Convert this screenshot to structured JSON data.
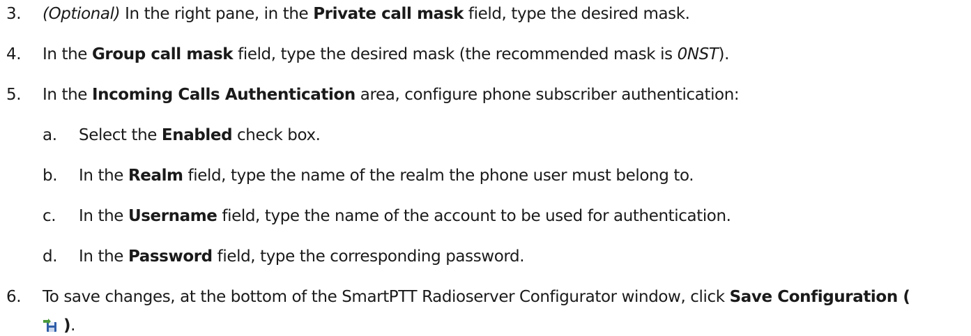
{
  "steps": [
    {
      "number": "3.",
      "optional_label": "(Optional)",
      "text_before": " In the right pane, in the ",
      "bold": "Private call mask",
      "text_after": " field, type the desired mask."
    },
    {
      "number": "4.",
      "text_before": "In the ",
      "bold": "Group call mask",
      "text_middle": " field, type the desired mask (the recommended mask is ",
      "italic": "0NST",
      "text_after": ")."
    },
    {
      "number": "5.",
      "text_before": "In the ",
      "bold": "Incoming Calls Authentication",
      "text_after": " area, configure phone subscriber authentication:",
      "substeps": [
        {
          "letter": "a.",
          "text_before": "Select the ",
          "bold": "Enabled",
          "text_after": " check box."
        },
        {
          "letter": "b.",
          "text_before": "In the ",
          "bold": "Realm",
          "text_after": " field, type the name of the realm the phone user must belong to."
        },
        {
          "letter": "c.",
          "text_before": "In the ",
          "bold": "Username",
          "text_after": " field, type the name of the account to be used for authentication."
        },
        {
          "letter": "d.",
          "text_before": "In the ",
          "bold": "Password",
          "text_after": " field, type the corresponding password."
        }
      ]
    },
    {
      "number": "6.",
      "text_before": "To save changes, at the bottom of the SmartPTT Radioserver Configurator window, click ",
      "bold": "Save Configuration (",
      "icon": "save-configuration-icon",
      "bold_end": ")",
      "text_after": "."
    }
  ],
  "colors": {
    "text": "#1a1a1a",
    "icon_disk": "#2f5ea8",
    "icon_arrow": "#4a9a3a"
  }
}
